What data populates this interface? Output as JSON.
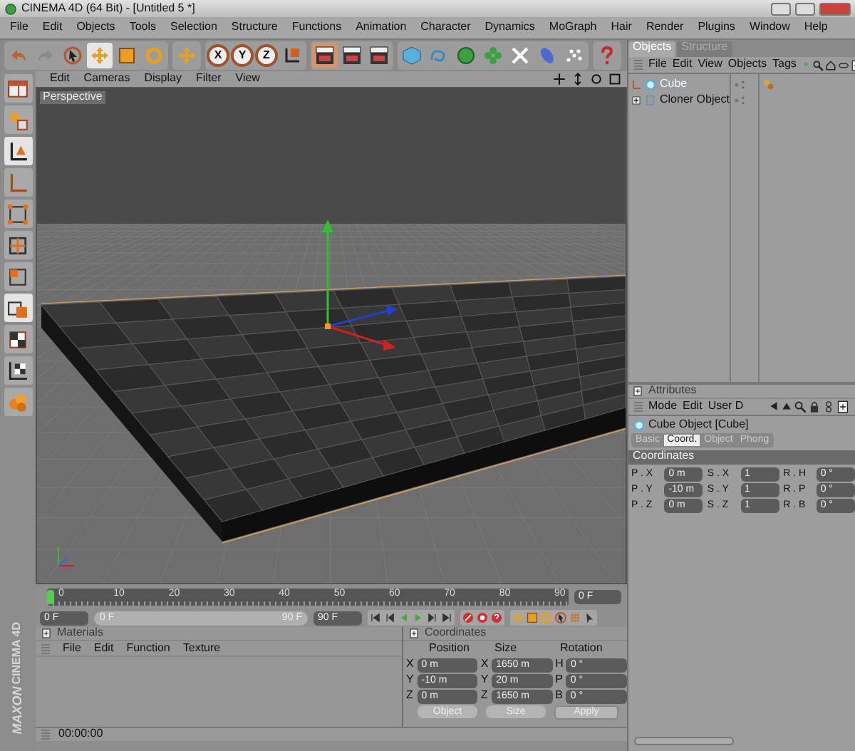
{
  "window": {
    "title": "CINEMA 4D (64 Bit) - [Untitled 5 *]"
  },
  "menu": [
    "File",
    "Edit",
    "Objects",
    "Tools",
    "Selection",
    "Structure",
    "Functions",
    "Animation",
    "Character",
    "Dynamics",
    "MoGraph",
    "Hair",
    "Render",
    "Plugins",
    "Window",
    "Help"
  ],
  "toolbar": {
    "axis_locks": [
      "X",
      "Y",
      "Z"
    ]
  },
  "viewport": {
    "menu": [
      "Edit",
      "Cameras",
      "Display",
      "Filter",
      "View"
    ],
    "label": "Perspective"
  },
  "timeline": {
    "ticks": [
      "0",
      "10",
      "20",
      "30",
      "40",
      "50",
      "60",
      "70",
      "80",
      "90"
    ],
    "level": 0,
    "current": "0 F",
    "start": "0 F",
    "range": {
      "start": "0 F",
      "end": "90 F",
      "level": 1
    },
    "end": "90 F"
  },
  "materials": {
    "title": "Materials",
    "menu": [
      "File",
      "Edit",
      "Function",
      "Texture"
    ]
  },
  "coordinates": {
    "title": "Coordinates",
    "headers": [
      "Position",
      "Size",
      "Rotation"
    ],
    "rows": [
      [
        {
          "axis": "X",
          "value": "0 m"
        },
        {
          "axis": "X",
          "value": "1650 m"
        },
        {
          "axis": "H",
          "value": "0 °"
        }
      ],
      [
        {
          "axis": "Y",
          "value": "-10 m"
        },
        {
          "axis": "Y",
          "value": "20 m"
        },
        {
          "axis": "P",
          "value": "0 °"
        }
      ],
      [
        {
          "axis": "Z",
          "value": "0 m"
        },
        {
          "axis": "Z",
          "value": "1650 m"
        },
        {
          "axis": "B",
          "value": "0 °"
        }
      ]
    ],
    "dropdowns": [
      "Object",
      "Size"
    ],
    "apply": "Apply"
  },
  "status": {
    "time": "00:00:00"
  },
  "logo": {
    "brand": "MAXON",
    "product": "CINEMA 4D"
  },
  "objects": {
    "tabs": [
      {
        "label": "Objects",
        "selected": true
      },
      {
        "label": "Structure",
        "selected": false
      }
    ],
    "menu": [
      "File",
      "Edit",
      "View",
      "Objects",
      "Tags"
    ],
    "tree": [
      {
        "name": "Cube",
        "selected": true
      },
      {
        "name": "Cloner Object",
        "selected": false
      }
    ]
  },
  "attributes": {
    "title": "Attributes",
    "menu": [
      "Mode",
      "Edit",
      "User D"
    ],
    "object": "Cube Object [Cube]",
    "tabs": [
      {
        "label": "Basic",
        "selected": false
      },
      {
        "label": "Coord.",
        "selected": true
      },
      {
        "label": "Object",
        "selected": false
      },
      {
        "label": "Phong",
        "selected": false
      }
    ],
    "section": "Coordinates",
    "rows": [
      [
        {
          "label": "P . X",
          "value": "0 m"
        },
        {
          "label": "S . X",
          "value": "1"
        },
        {
          "label": "R . H",
          "value": "0 °"
        }
      ],
      [
        {
          "label": "P . Y",
          "value": "-10 m"
        },
        {
          "label": "S . Y",
          "value": "1"
        },
        {
          "label": "R . P",
          "value": "0 °"
        }
      ],
      [
        {
          "label": "P . Z",
          "value": "0 m"
        },
        {
          "label": "S . Z",
          "value": "1"
        },
        {
          "label": "R . B",
          "value": "0 °"
        }
      ]
    ]
  }
}
